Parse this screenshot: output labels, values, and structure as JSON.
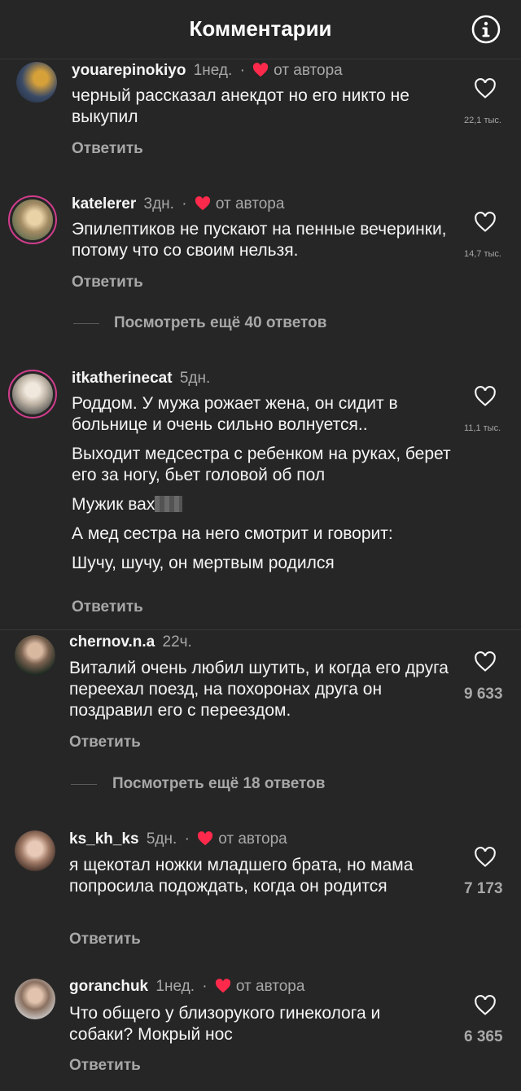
{
  "header": {
    "title": "Комментарии"
  },
  "comments": [
    {
      "username": "youarepinokiyo",
      "time": "1нед.",
      "author_badge": "от автора",
      "lines": [
        "черный рассказал анекдот но его никто не выкупил"
      ],
      "reply": "Ответить",
      "likes": "22,1 тыс."
    },
    {
      "username": "katelerer",
      "time": "3дн.",
      "author_badge": "от автора",
      "lines": [
        "Эпилептиков не пускают на пенные вечеринки, потому что со своим нельзя."
      ],
      "reply": "Ответить",
      "likes": "14,7 тыс.",
      "more": "Посмотреть ещё 40 ответов"
    },
    {
      "username": "itkatherinecat",
      "time": "5дн.",
      "lines": [
        "Роддом. У мужа рожает жена, он сидит в больнице и очень сильно волнуется..",
        "Выходит медсестра с ребенком на руках, берет его за ногу, бьет головой об пол",
        "Мужик вах",
        "А мед сестра на него смотрит и говорит:",
        "Шучу, шучу, он мертвым родился"
      ],
      "reply": "Ответить",
      "likes": "11,1 тыс."
    },
    {
      "username": "chernov.n.a",
      "time": "22ч.",
      "lines": [
        "Виталий очень любил шутить, и когда его друга переехал поезд, на похоронах друга он поздравил его с переездом."
      ],
      "reply": "Ответить",
      "likes": "9 633",
      "more": "Посмотреть ещё 18 ответов"
    },
    {
      "username": "ks_kh_ks",
      "time": "5дн.",
      "author_badge": "от автора",
      "lines": [
        "я щекотал ножки младшего брата, но мама попросила подождать, когда он родится"
      ],
      "reply": "Ответить",
      "likes": "7 173"
    },
    {
      "username": "goranchuk",
      "time": "1нед.",
      "author_badge": "от автора",
      "lines": [
        "Что общего у близорукого гинеколога и собаки? Мокрый нос"
      ],
      "reply": "Ответить",
      "likes": "6 365"
    }
  ],
  "colors": {
    "background": "#262626",
    "author_heart": "#ff2a4b",
    "secondary_text": "#a8a8a8"
  },
  "icons": {
    "info": "info-circle-icon",
    "like": "heart-outline-icon",
    "author_like": "heart-filled-icon"
  }
}
